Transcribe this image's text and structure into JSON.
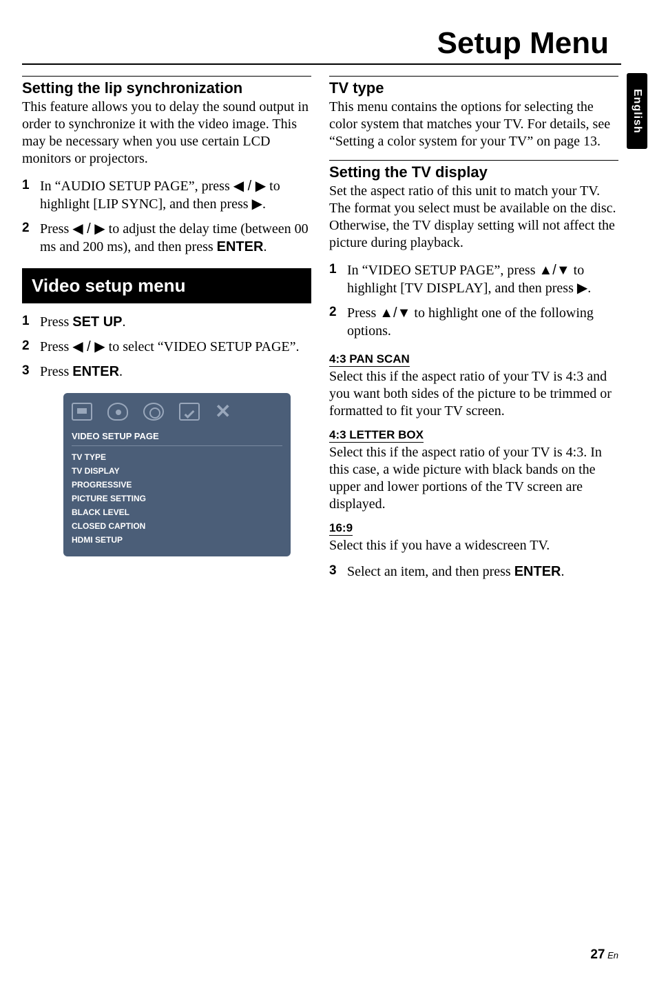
{
  "page_title": "Setup Menu",
  "side_tab": "English",
  "left": {
    "lip_sync": {
      "heading": "Setting the lip synchronization",
      "body": "This feature allows you to delay the sound output in order to synchronize it with the video image. This may be necessary when you use certain LCD monitors or projectors.",
      "steps": [
        {
          "pre": "In “AUDIO SETUP PAGE”, press ",
          "arrows": "◀ / ▶",
          "mid": " to highlight [LIP SYNC], and then press ",
          "arrow2": "▶",
          "post": "."
        },
        {
          "pre": "Press ",
          "arrows": "◀ / ▶",
          "mid": " to adjust the delay time (between 00 ms and 200 ms), and then press ",
          "hv": "ENTER",
          "post": "."
        }
      ]
    },
    "video_block_title": "Video setup menu",
    "video_steps": [
      {
        "pre": "Press ",
        "hv": "SET UP",
        "post": "."
      },
      {
        "pre": "Press ",
        "arrows": "◀ / ▶",
        "mid": " to select “VIDEO SETUP PAGE”."
      },
      {
        "pre": "Press ",
        "hv": "ENTER",
        "post": "."
      }
    ],
    "menu_shot": {
      "title": "VIDEO SETUP PAGE",
      "items": [
        "TV TYPE",
        "TV DISPLAY",
        "PROGRESSIVE",
        "PICTURE SETTING",
        "BLACK LEVEL",
        "CLOSED CAPTION",
        "HDMI SETUP"
      ]
    }
  },
  "right": {
    "tv_type": {
      "heading": "TV type",
      "body": "This menu contains the options for selecting the color system that matches your TV. For details, see “Setting a color system for your TV” on page 13."
    },
    "tv_display": {
      "heading": "Setting the TV display",
      "body": "Set the aspect ratio of this unit to match your TV. The format you select must be available on the disc. Otherwise, the TV display setting will not affect the picture during playback.",
      "steps": [
        {
          "pre": "In “VIDEO SETUP PAGE”, press ",
          "arrows": "▲/▼",
          "mid": " to highlight [TV DISPLAY], and then press ",
          "arrow2": "▶",
          "post": "."
        },
        {
          "pre": "Press ",
          "arrows": "▲/▼",
          "mid": " to highlight one of the following options."
        }
      ],
      "opts": [
        {
          "name": "4:3 PAN SCAN",
          "text": "Select this if the aspect ratio of your TV is 4:3 and you want both sides of the picture to be trimmed or formatted to fit your TV screen."
        },
        {
          "name": "4:3 LETTER BOX",
          "text": "Select this if the aspect ratio of your TV is 4:3. In this case, a wide picture with black bands on the upper and lower portions of the TV screen are displayed."
        },
        {
          "name": "16:9",
          "text": "Select this if you have a widescreen TV."
        }
      ],
      "step3": {
        "pre": "Select an item, and then press ",
        "hv": "ENTER",
        "post": "."
      }
    }
  },
  "pagenum": {
    "n": "27",
    "suffix": " En"
  }
}
